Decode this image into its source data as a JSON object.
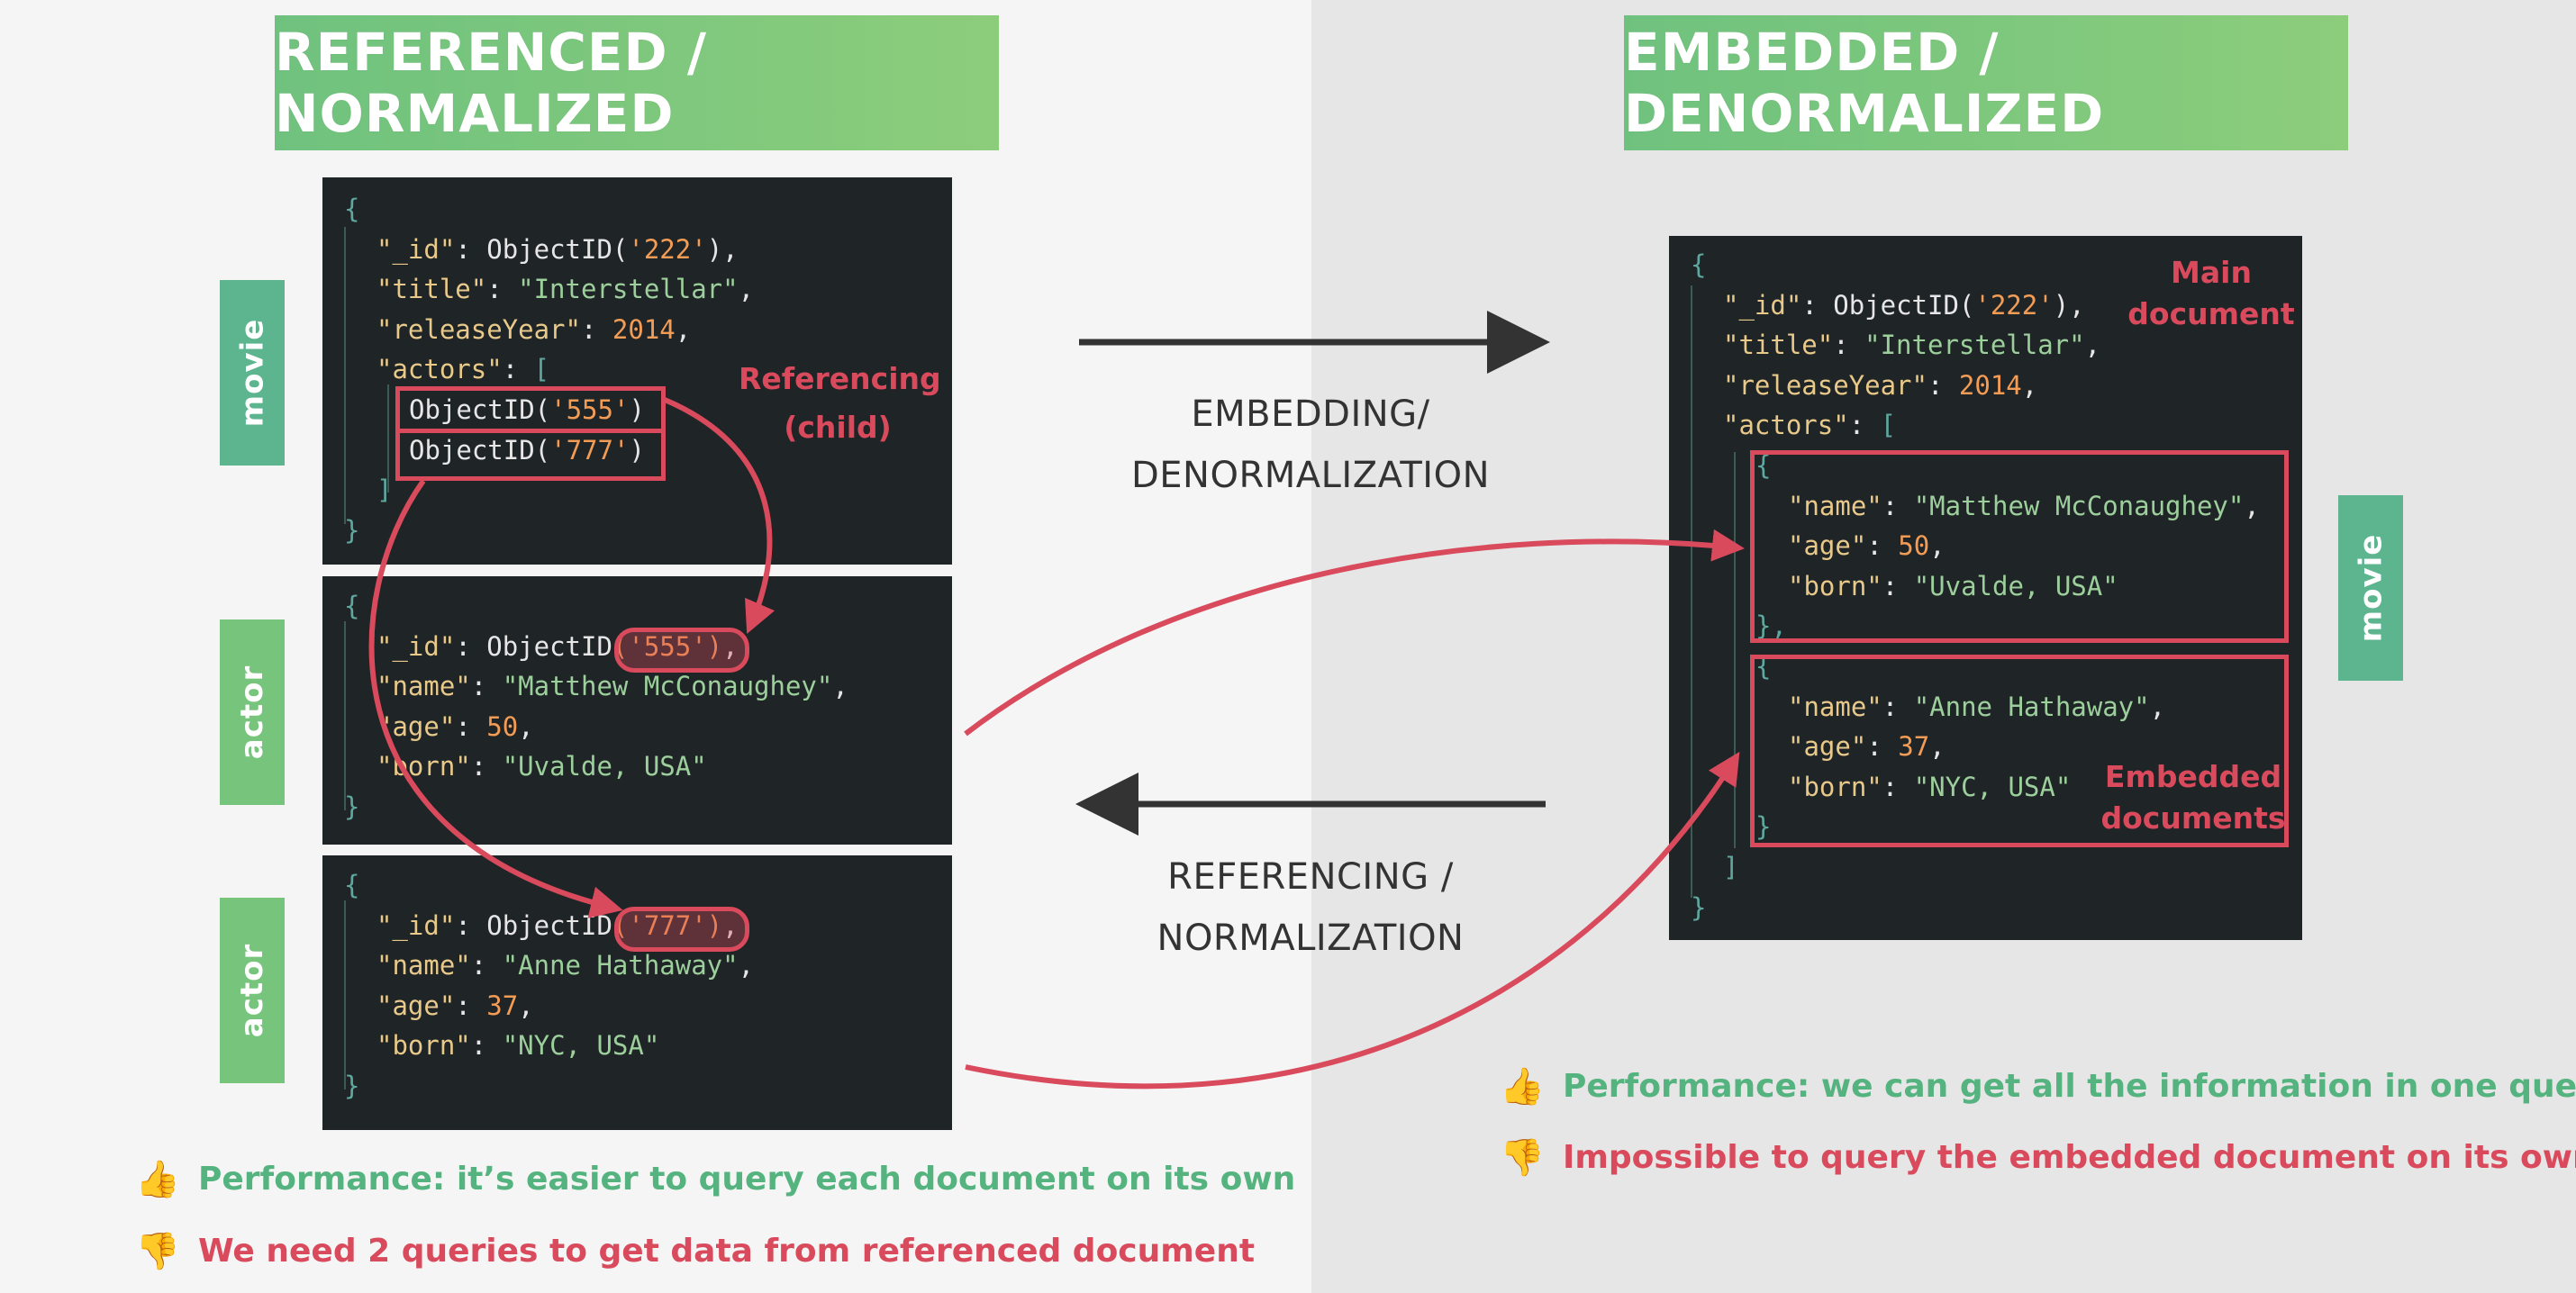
{
  "left_title": "REFERENCED / NORMALIZED",
  "right_title": "EMBEDDED / DENORMALIZED",
  "labels": {
    "movie": "movie",
    "actor": "actor"
  },
  "movie_doc": {
    "open": "{",
    "id_key": "\"_id\"",
    "id_fn": "ObjectID(",
    "id_val": "'222'",
    "id_end": "),",
    "title_key": "\"title\"",
    "title_val": "\"Interstellar\"",
    "year_key": "\"releaseYear\"",
    "year_val": "2014",
    "actors_key": "\"actors\"",
    "bracket_open": "[",
    "ref1_fn": "ObjectID(",
    "ref1_val": "'555'",
    "ref1_end": ")",
    "ref2_fn": "ObjectID(",
    "ref2_val": "'777'",
    "ref2_end": ")",
    "bracket_close": "]",
    "close": "}"
  },
  "actor1_doc": {
    "open": "{",
    "id_key": "\"_id\"",
    "id_fn": "ObjectID",
    "id_val": "('555')",
    "id_end": ",",
    "name_key": "\"name\"",
    "name_val": "\"Matthew McConaughey\"",
    "age_key": "\"age\"",
    "age_val": "50",
    "born_key": "\"born\"",
    "born_val": "\"Uvalde, USA\"",
    "close": "}"
  },
  "actor2_doc": {
    "open": "{",
    "id_key": "\"_id\"",
    "id_fn": "ObjectID",
    "id_val": "('777')",
    "id_end": ",",
    "name_key": "\"name\"",
    "name_val": "\"Anne Hathaway\"",
    "age_key": "\"age\"",
    "age_val": "37",
    "born_key": "\"born\"",
    "born_val": "\"NYC, USA\"",
    "close": "}"
  },
  "embedded_doc": {
    "open": "{",
    "id_key": "\"_id\"",
    "id_fn": "ObjectID(",
    "id_val": "'222'",
    "id_end": "),",
    "title_key": "\"title\"",
    "title_val": "\"Interstellar\"",
    "year_key": "\"releaseYear\"",
    "year_val": "2014",
    "actors_key": "\"actors\"",
    "bracket_open": "[",
    "sub_open1": "{",
    "name1_key": "\"name\"",
    "name1_val": "\"Matthew McConaughey\"",
    "age1_key": "\"age\"",
    "age1_val": "50",
    "born1_key": "\"born\"",
    "born1_val": "\"Uvalde, USA\"",
    "sub_close1": "},",
    "sub_open2": "{",
    "name2_key": "\"name\"",
    "name2_val": "\"Anne Hathaway\"",
    "age2_key": "\"age\"",
    "age2_val": "37",
    "born2_key": "\"born\"",
    "born2_val": "\"NYC, USA\"",
    "sub_close2": "}",
    "bracket_close": "]",
    "close": "}"
  },
  "notes": {
    "referencing_child_1": "Referencing",
    "referencing_child_2": "(child)",
    "main_document_1": "Main",
    "main_document_2": "document",
    "embedded_documents_1": "Embedded",
    "embedded_documents_2": "documents"
  },
  "center": {
    "top_1": "EMBEDDING/",
    "top_2": "DENORMALIZATION",
    "bottom_1": "REFERENCING /",
    "bottom_2": "NORMALIZATION"
  },
  "bullets": {
    "left_pro": "Performance: it’s easier to query each document on its own",
    "left_con": "We need 2 queries to get data from referenced document",
    "right_pro": "Performance: we can get all the information in one query",
    "right_con": "Impossible to query the embedded document on its own"
  },
  "icons": {
    "pro": "thumbs-up-icon",
    "con": "thumbs-down-icon"
  },
  "colors": {
    "accent_red": "#d84a5c",
    "banner_green": "#77c57d",
    "pro_green": "#55b37f",
    "code_bg": "#1f2427"
  }
}
